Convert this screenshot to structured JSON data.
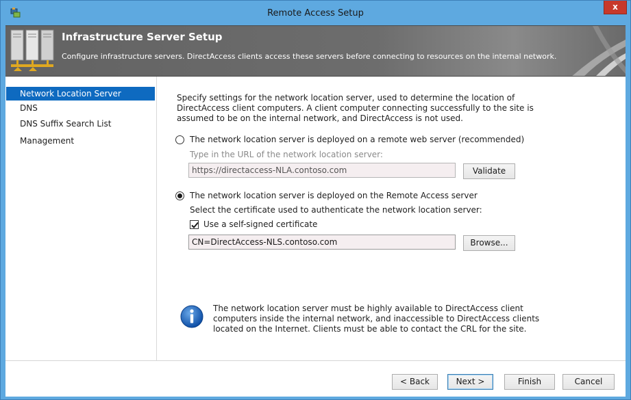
{
  "window": {
    "title": "Remote Access Setup",
    "close_label": "x"
  },
  "header": {
    "title": "Infrastructure Server Setup",
    "description": "Configure infrastructure servers. DirectAccess clients access these servers before connecting to resources on the internal network."
  },
  "sidebar": {
    "items": [
      {
        "label": "Network Location Server"
      },
      {
        "label": "DNS"
      },
      {
        "label": "DNS Suffix Search List"
      },
      {
        "label": "Management"
      }
    ]
  },
  "main": {
    "intro": "Specify settings for the network location server, used to determine the location of DirectAccess client computers. A client computer connecting successfully to the site is assumed to be on the internal network, and DirectAccess is not used.",
    "option_remote": {
      "label": "The network location server is deployed on a remote web server (recommended)",
      "checked": false,
      "url_hint": "Type in the URL of the network location server:",
      "url_value": "https://directaccess-NLA.contoso.com",
      "validate_label": "Validate"
    },
    "option_local": {
      "label": "The network location server is deployed on the Remote Access server",
      "checked": true,
      "cert_hint": "Select the certificate used to authenticate the network location server:",
      "self_signed_label": "Use a self-signed certificate",
      "self_signed_checked": true,
      "cert_value": "CN=DirectAccess-NLS.contoso.com",
      "browse_label": "Browse..."
    },
    "info_text": "The network location server must be highly available to DirectAccess client computers inside the internal network, and inaccessible to DirectAccess clients located on the Internet. Clients must be able to contact the CRL for the site."
  },
  "footer": {
    "back_label": "< Back",
    "next_label": "Next >",
    "finish_label": "Finish",
    "cancel_label": "Cancel"
  },
  "colors": {
    "titlebar": "#5ea9e0",
    "selection": "#0e6ac0",
    "close": "#c7392b",
    "header_bg": "#6d6d6d"
  }
}
